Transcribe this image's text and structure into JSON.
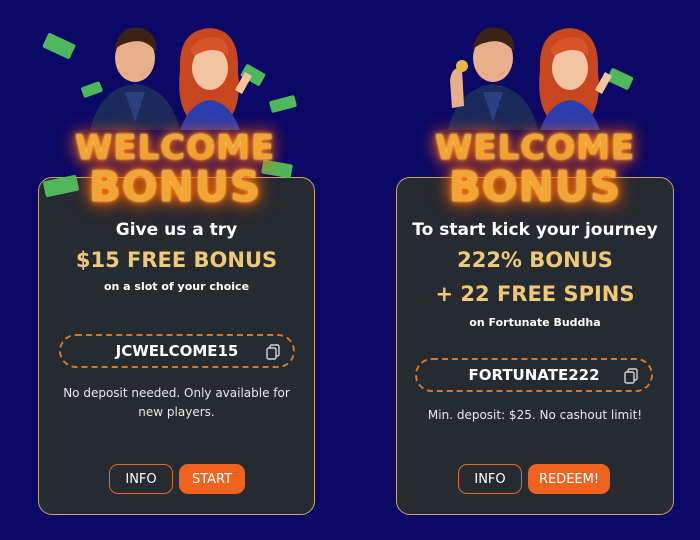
{
  "colors": {
    "background": "#0b0866",
    "card": "#262a31",
    "accent": "#f0631e",
    "gold": "#efc978"
  },
  "offers": [
    {
      "welcome_top": "WELCOME",
      "welcome_bottom": "BONUS",
      "headline": "Give us a try",
      "bonus_lines": [
        "$15 FREE BONUS"
      ],
      "subtitle": "on a slot of your choice",
      "code": "JCWELCOME15",
      "note": "No deposit needed. Only available for new players.",
      "info_label": "INFO",
      "action_label": "START"
    },
    {
      "welcome_top": "WELCOME",
      "welcome_bottom": "BONUS",
      "headline": "To start kick your journey",
      "bonus_lines": [
        "222% BONUS",
        "+ 22 FREE SPINS"
      ],
      "subtitle": "on Fortunate Buddha",
      "code": "FORTUNATE222",
      "note": "Min. deposit: $25. No cashout limit!",
      "info_label": "INFO",
      "action_label": "REDEEM!"
    }
  ],
  "icons": {
    "copy": "copy-icon",
    "money": "money-bill-icon"
  }
}
